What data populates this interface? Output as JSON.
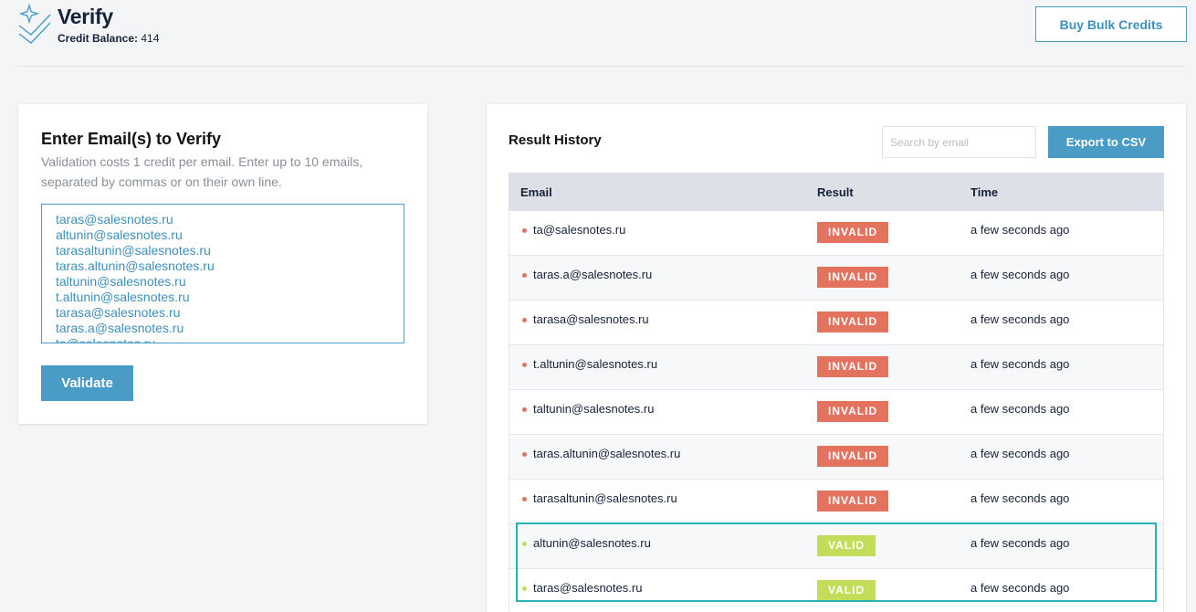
{
  "header": {
    "title": "Verify",
    "credit_label": "Credit Balance:",
    "credit_value": "414",
    "buy_label": "Buy Bulk Credits"
  },
  "verify_card": {
    "title": "Enter Email(s) to Verify",
    "description": "Validation costs 1 credit per email. Enter up to 10 emails, separated by commas or on their own line.",
    "emails": [
      "taras@salesnotes.ru",
      "altunin@salesnotes.ru",
      "tarasaltunin@salesnotes.ru",
      "taras.altunin@salesnotes.ru",
      "taltunin@salesnotes.ru",
      "t.altunin@salesnotes.ru",
      "tarasa@salesnotes.ru",
      "taras.a@salesnotes.ru",
      "ta@salesnotes.ru"
    ],
    "validate_label": "Validate"
  },
  "history": {
    "title": "Result History",
    "search_placeholder": "Search by email",
    "export_label": "Export to CSV",
    "columns": [
      "Email",
      "Result",
      "Time"
    ],
    "rows": [
      {
        "email": "ta@salesnotes.ru",
        "result": "INVALID",
        "time": "a few seconds ago"
      },
      {
        "email": "taras.a@salesnotes.ru",
        "result": "INVALID",
        "time": "a few seconds ago"
      },
      {
        "email": "tarasa@salesnotes.ru",
        "result": "INVALID",
        "time": "a few seconds ago"
      },
      {
        "email": "t.altunin@salesnotes.ru",
        "result": "INVALID",
        "time": "a few seconds ago"
      },
      {
        "email": "taltunin@salesnotes.ru",
        "result": "INVALID",
        "time": "a few seconds ago"
      },
      {
        "email": "taras.altunin@salesnotes.ru",
        "result": "INVALID",
        "time": "a few seconds ago"
      },
      {
        "email": "tarasaltunin@salesnotes.ru",
        "result": "INVALID",
        "time": "a few seconds ago"
      },
      {
        "email": "altunin@salesnotes.ru",
        "result": "VALID",
        "time": "a few seconds ago"
      },
      {
        "email": "taras@salesnotes.ru",
        "result": "VALID",
        "time": "a few seconds ago"
      }
    ]
  },
  "colors": {
    "accent": "#4a9bc5",
    "invalid": "#e3735e",
    "valid": "#c2dd5a",
    "highlight": "#2ab2b2"
  }
}
